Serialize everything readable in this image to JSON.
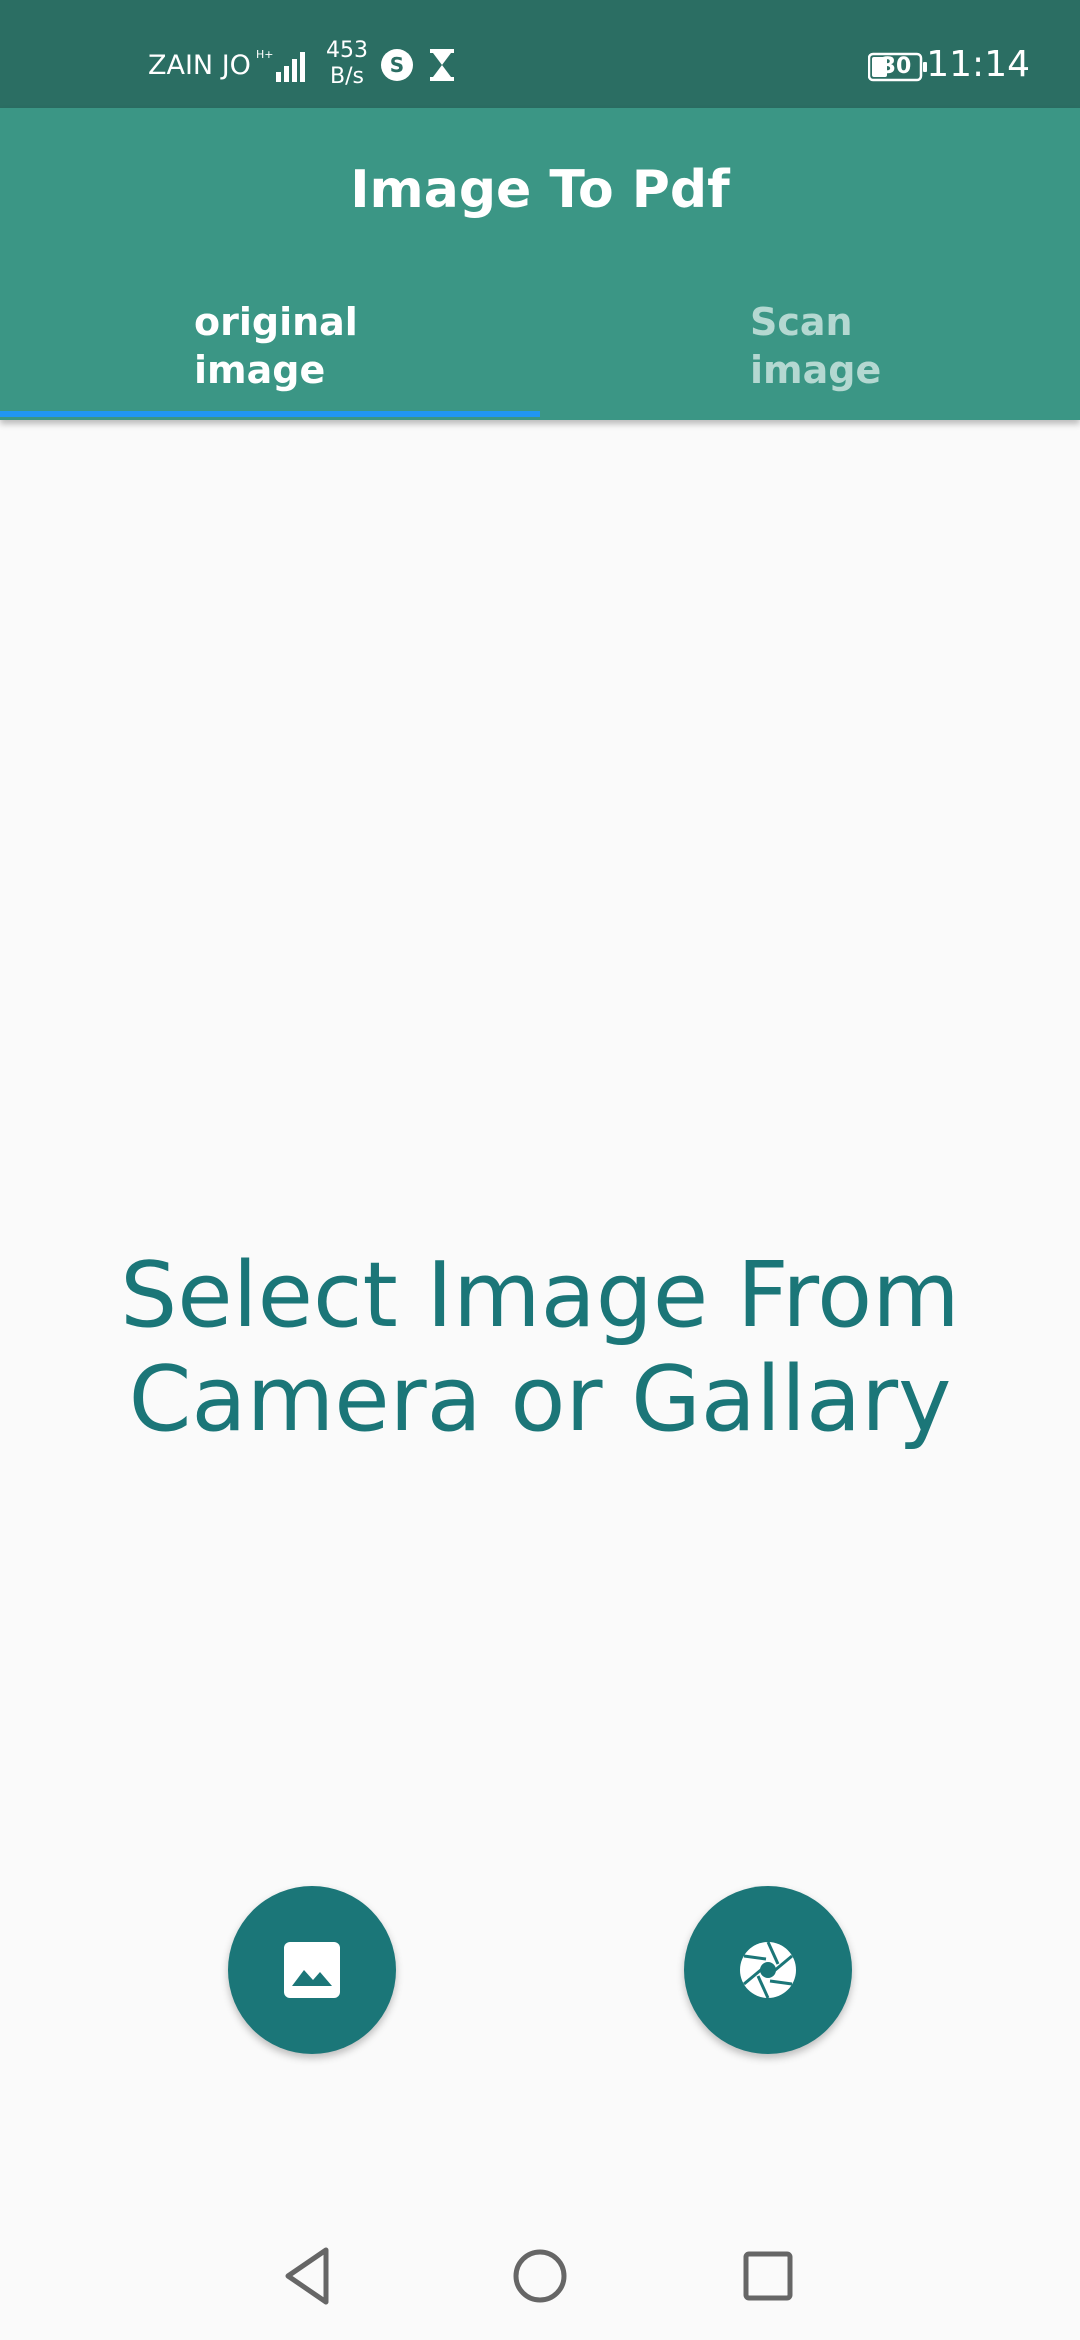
{
  "status_bar": {
    "carrier": "ZAIN JO",
    "network_speed_value": "453",
    "network_speed_unit": "B/s",
    "battery_level": "30",
    "time": "11:14",
    "icons": [
      "signal-icon",
      "sync-s-icon",
      "hourglass-icon",
      "battery-icon"
    ]
  },
  "app_bar": {
    "title": "Image To Pdf",
    "tabs": [
      {
        "line1": "original",
        "line2": "image",
        "selected": true
      },
      {
        "line1": "Scan",
        "line2": "image",
        "selected": false
      }
    ]
  },
  "main": {
    "prompt_line1": "Select Image From",
    "prompt_line2": "Camera or Gallary"
  },
  "fabs": [
    {
      "name": "gallery-button",
      "icon": "image-icon"
    },
    {
      "name": "camera-button",
      "icon": "camera-aperture-icon"
    }
  ],
  "nav_bar": {
    "icons": [
      "back-icon",
      "home-icon",
      "recent-apps-icon"
    ]
  },
  "colors": {
    "status_bar": "#2b6e63",
    "app_bar": "#3b9685",
    "tab_indicator": "#2196f3",
    "accent": "#1b7678",
    "background": "#fafafa",
    "inactive_tab": "#b4d8d1"
  }
}
